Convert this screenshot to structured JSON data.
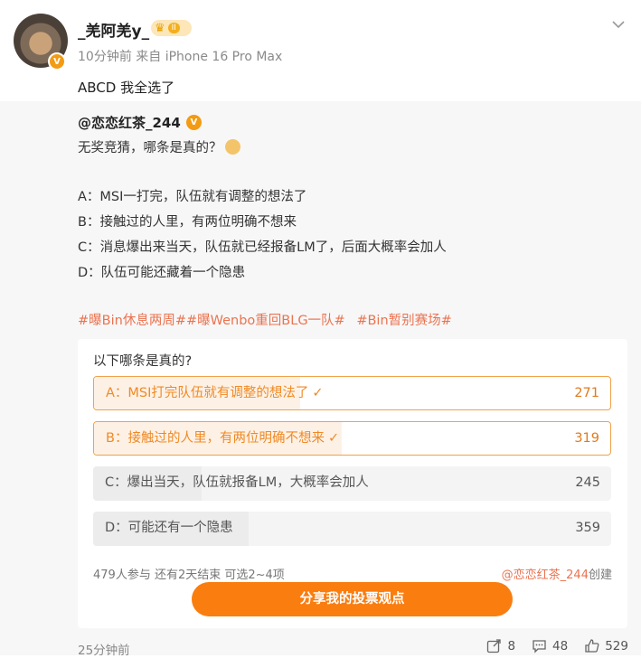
{
  "post": {
    "username": "_羌阿羌y_",
    "level_badge": "II",
    "verified_mark": "V",
    "meta": "10分钟前  来自 iPhone 16 Pro Max",
    "text": "ABCD 我全选了"
  },
  "repost": {
    "author": "@恋恋红茶_244",
    "intro": "无奖竞猜，哪条是真的？",
    "lines": [
      "A：MSI一打完，队伍就有调整的想法了",
      "B：接触过的人里，有两位明确不想来",
      "C：消息爆出来当天，队伍就已经报备LM了，后面大概率会加人",
      "D：队伍可能还藏着一个隐患"
    ],
    "hashtags": [
      "#曝Bin休息两周##曝Wenbo重回BLG一队#",
      "#Bin暂别赛场#"
    ]
  },
  "poll": {
    "question": "以下哪条是真的?",
    "options": [
      {
        "label": "A：MSI打完队伍就有调整的想法了",
        "count": "271",
        "selected": true,
        "check": "✓"
      },
      {
        "label": "B：接触过的人里，有两位明确不想来",
        "count": "319",
        "selected": true,
        "check": "✓"
      },
      {
        "label": "C：爆出当天，队伍就报备LM，大概率会加人",
        "count": "245",
        "selected": false
      },
      {
        "label": "D：可能还有一个隐患",
        "count": "359",
        "selected": false
      }
    ],
    "stats": "479人参与  还有2天结束  可选2~4项",
    "creator_name": "@恋恋红茶_244",
    "creator_suffix": "创建",
    "share_label": "分享我的投票观点"
  },
  "footer": {
    "time": "25分钟前",
    "repost_count": "8",
    "comment_count": "48",
    "like_count": "529"
  },
  "colors": {
    "accent": "#fa7d0f",
    "hashtag": "#eb7350",
    "verified": "#f39b12"
  }
}
